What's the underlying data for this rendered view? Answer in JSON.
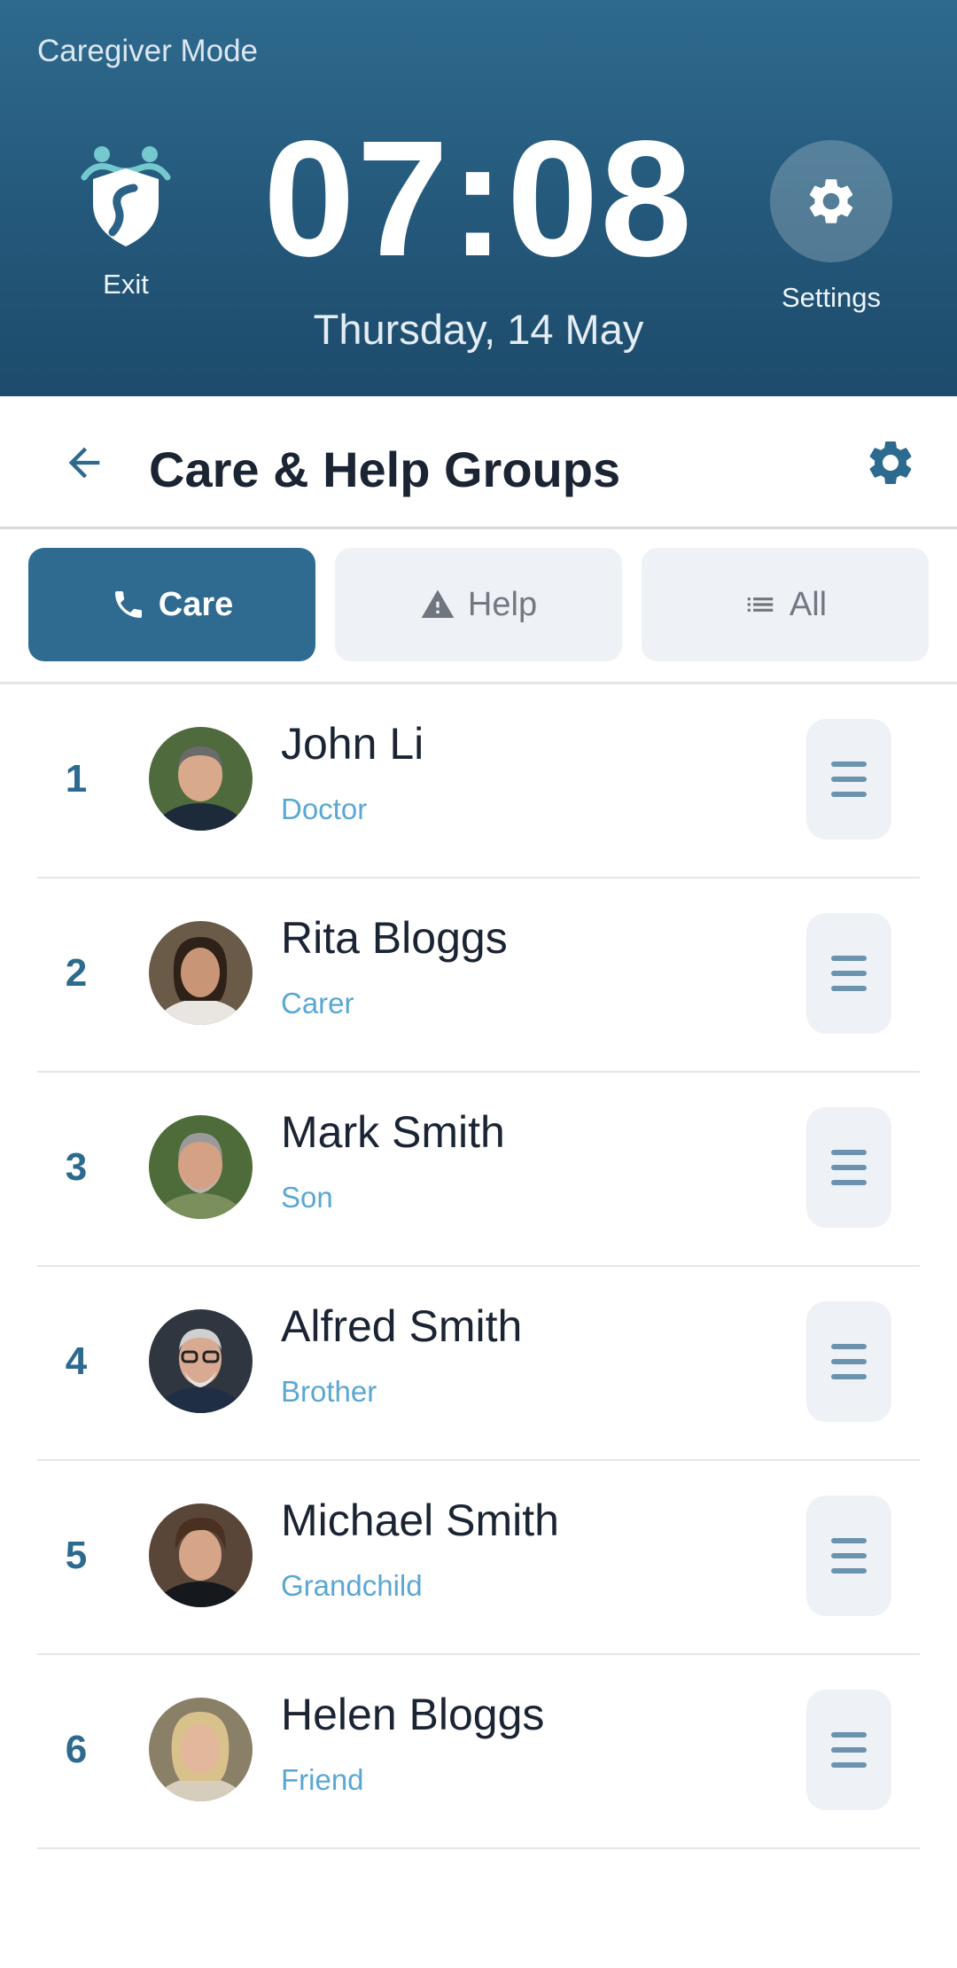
{
  "header": {
    "mode_label": "Caregiver Mode",
    "time": "07:08",
    "date": "Thursday, 14 May",
    "exit_label": "Exit",
    "settings_label": "Settings",
    "background_color": "#24587a"
  },
  "titlebar": {
    "title": "Care & Help Groups",
    "back_icon": "arrow-left-icon",
    "settings_icon": "gear-icon"
  },
  "tabs": [
    {
      "label": "Care",
      "icon": "phone-icon",
      "selected": true
    },
    {
      "label": "Help",
      "icon": "warning-icon",
      "selected": false
    },
    {
      "label": "All",
      "icon": "list-icon",
      "selected": false
    }
  ],
  "contacts": [
    {
      "number": "1",
      "name": "John Li",
      "role": "Doctor"
    },
    {
      "number": "2",
      "name": "Rita Bloggs",
      "role": "Carer"
    },
    {
      "number": "3",
      "name": "Mark Smith",
      "role": "Son"
    },
    {
      "number": "4",
      "name": "Alfred Smith",
      "role": "Brother"
    },
    {
      "number": "5",
      "name": "Michael Smith",
      "role": "Grandchild"
    },
    {
      "number": "6",
      "name": "Helen Bloggs",
      "role": "Friend"
    }
  ],
  "colors": {
    "accent": "#2f6b90",
    "role_text": "#5aa7d3",
    "tab_inactive_bg": "#eef1f5"
  }
}
